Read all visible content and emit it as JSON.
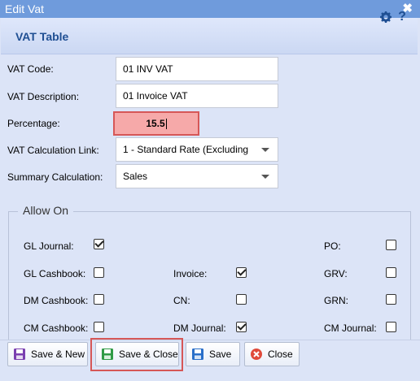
{
  "window": {
    "title": "Edit Vat",
    "close_glyph": "✖"
  },
  "panel": {
    "title": "VAT Table",
    "help_glyph": "?",
    "icons": [
      "gear-icon",
      "help-icon"
    ]
  },
  "form": {
    "vat_code_label": "VAT Code:",
    "vat_code_value": "01 INV VAT",
    "vat_description_label": "VAT Description:",
    "vat_description_value": "01 Invoice VAT",
    "percentage_label": "Percentage:",
    "percentage_value": "15.5",
    "calc_link_label": "VAT Calculation Link:",
    "calc_link_value": "1 - Standard Rate (Excluding",
    "summary_label": "Summary Calculation:",
    "summary_value": "Sales"
  },
  "allow_on": {
    "legend": "Allow On",
    "items": [
      {
        "label": "GL Journal:",
        "checked": true
      },
      {
        "label": "GL Cashbook:",
        "checked": false
      },
      {
        "label": "DM Cashbook:",
        "checked": false
      },
      {
        "label": "CM Cashbook:",
        "checked": false
      },
      {
        "label": "Invoice:",
        "checked": true
      },
      {
        "label": "CN:",
        "checked": false
      },
      {
        "label": "DM Journal:",
        "checked": true
      },
      {
        "label": "PO:",
        "checked": false
      },
      {
        "label": "GRV:",
        "checked": false
      },
      {
        "label": "GRN:",
        "checked": false
      },
      {
        "label": "CM Journal:",
        "checked": false
      }
    ]
  },
  "toolbar": {
    "save_new_label": "Save & New",
    "save_close_label": "Save & Close",
    "save_label": "Save",
    "close_label": "Close"
  },
  "colors": {
    "titlebar": "#6f9bdc",
    "accent": "#1f4f93",
    "highlight": "#d65757",
    "percentage_bg": "#f6a9a9"
  }
}
